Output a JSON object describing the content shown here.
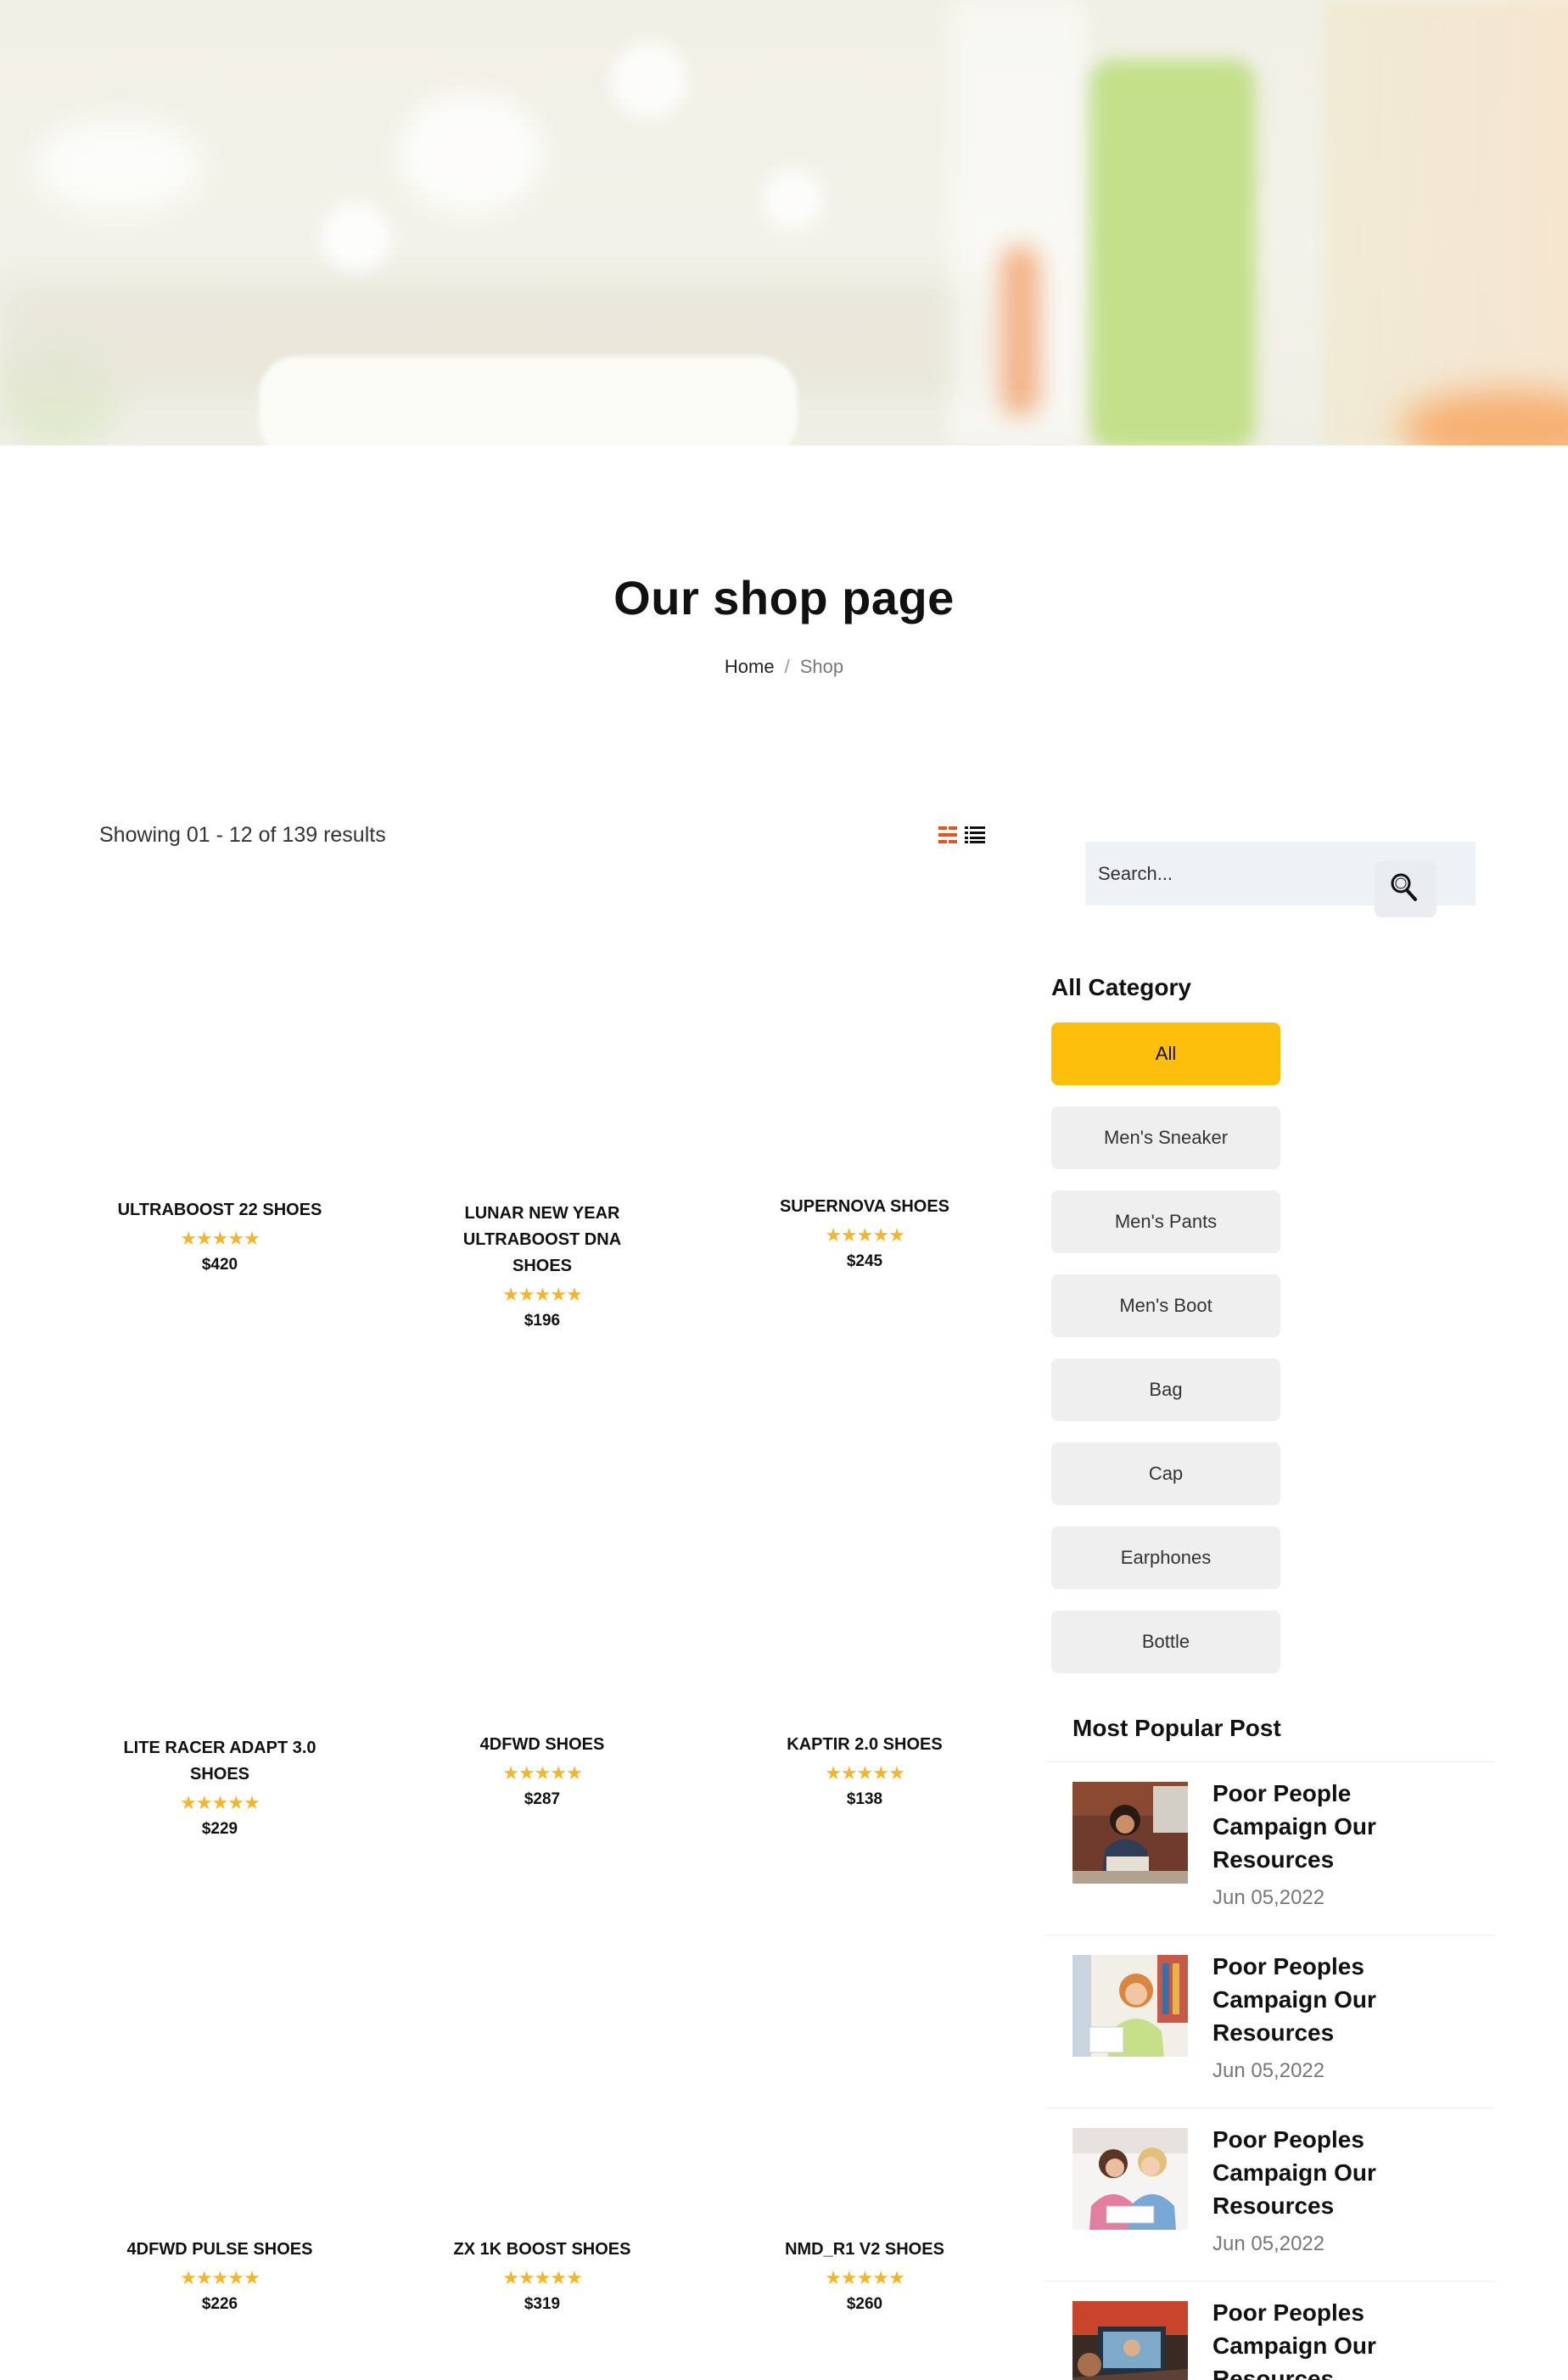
{
  "page": {
    "title": "Our shop page",
    "breadcrumb": {
      "home": "Home",
      "separator": "/",
      "current": "Shop"
    }
  },
  "toolbar": {
    "result_count": "Showing 01 - 12 of 139 results",
    "views": [
      "grid-view-icon",
      "list-view-icon"
    ],
    "active_view_color": "#e8501e"
  },
  "products": [
    {
      "name": "ULTRABOOST 22 SHOES",
      "rating": 5,
      "stars": "★★★★★",
      "price": "$420"
    },
    {
      "name": "LUNAR NEW YEAR ULTRABOOST DNA SHOES",
      "rating": 5,
      "stars": "★★★★★",
      "price": "$196"
    },
    {
      "name": "SUPERNOVA SHOES",
      "rating": 5,
      "stars": "★★★★★",
      "price": "$245"
    },
    {
      "name": "LITE RACER ADAPT 3.0 SHOES",
      "rating": 5,
      "stars": "★★★★★",
      "price": "$229"
    },
    {
      "name": "4DFWD SHOES",
      "rating": 5,
      "stars": "★★★★★",
      "price": "$287"
    },
    {
      "name": "KAPTIR 2.0 SHOES",
      "rating": 5,
      "stars": "★★★★★",
      "price": "$138"
    },
    {
      "name": "4DFWD PULSE SHOES",
      "rating": 5,
      "stars": "★★★★★",
      "price": "$226"
    },
    {
      "name": "ZX 1K BOOST SHOES",
      "rating": 5,
      "stars": "★★★★★",
      "price": "$319"
    },
    {
      "name": "NMD_R1 V2 SHOES",
      "rating": 5,
      "stars": "★★★★★",
      "price": "$260"
    }
  ],
  "sidebar": {
    "search": {
      "placeholder": "Search...",
      "icon": "search-icon"
    },
    "category_title": "All Category",
    "categories": [
      "All",
      "Men's Sneaker",
      "Men's Pants",
      "Men's Boot",
      "Bag",
      "Cap",
      "Earphones",
      "Bottle"
    ],
    "active_category": "All",
    "active_color": "#fdbe0c",
    "popular_title": "Most Popular Post",
    "posts": [
      {
        "title": "Poor People Campaign Our Resources",
        "date": "Jun 05,2022"
      },
      {
        "title": "Poor Peoples Campaign Our Resources",
        "date": "Jun 05,2022"
      },
      {
        "title": "Poor Peoples Campaign Our Resources",
        "date": "Jun 05,2022"
      },
      {
        "title": "Poor Peoples Campaign Our Resources",
        "date": ""
      }
    ]
  }
}
